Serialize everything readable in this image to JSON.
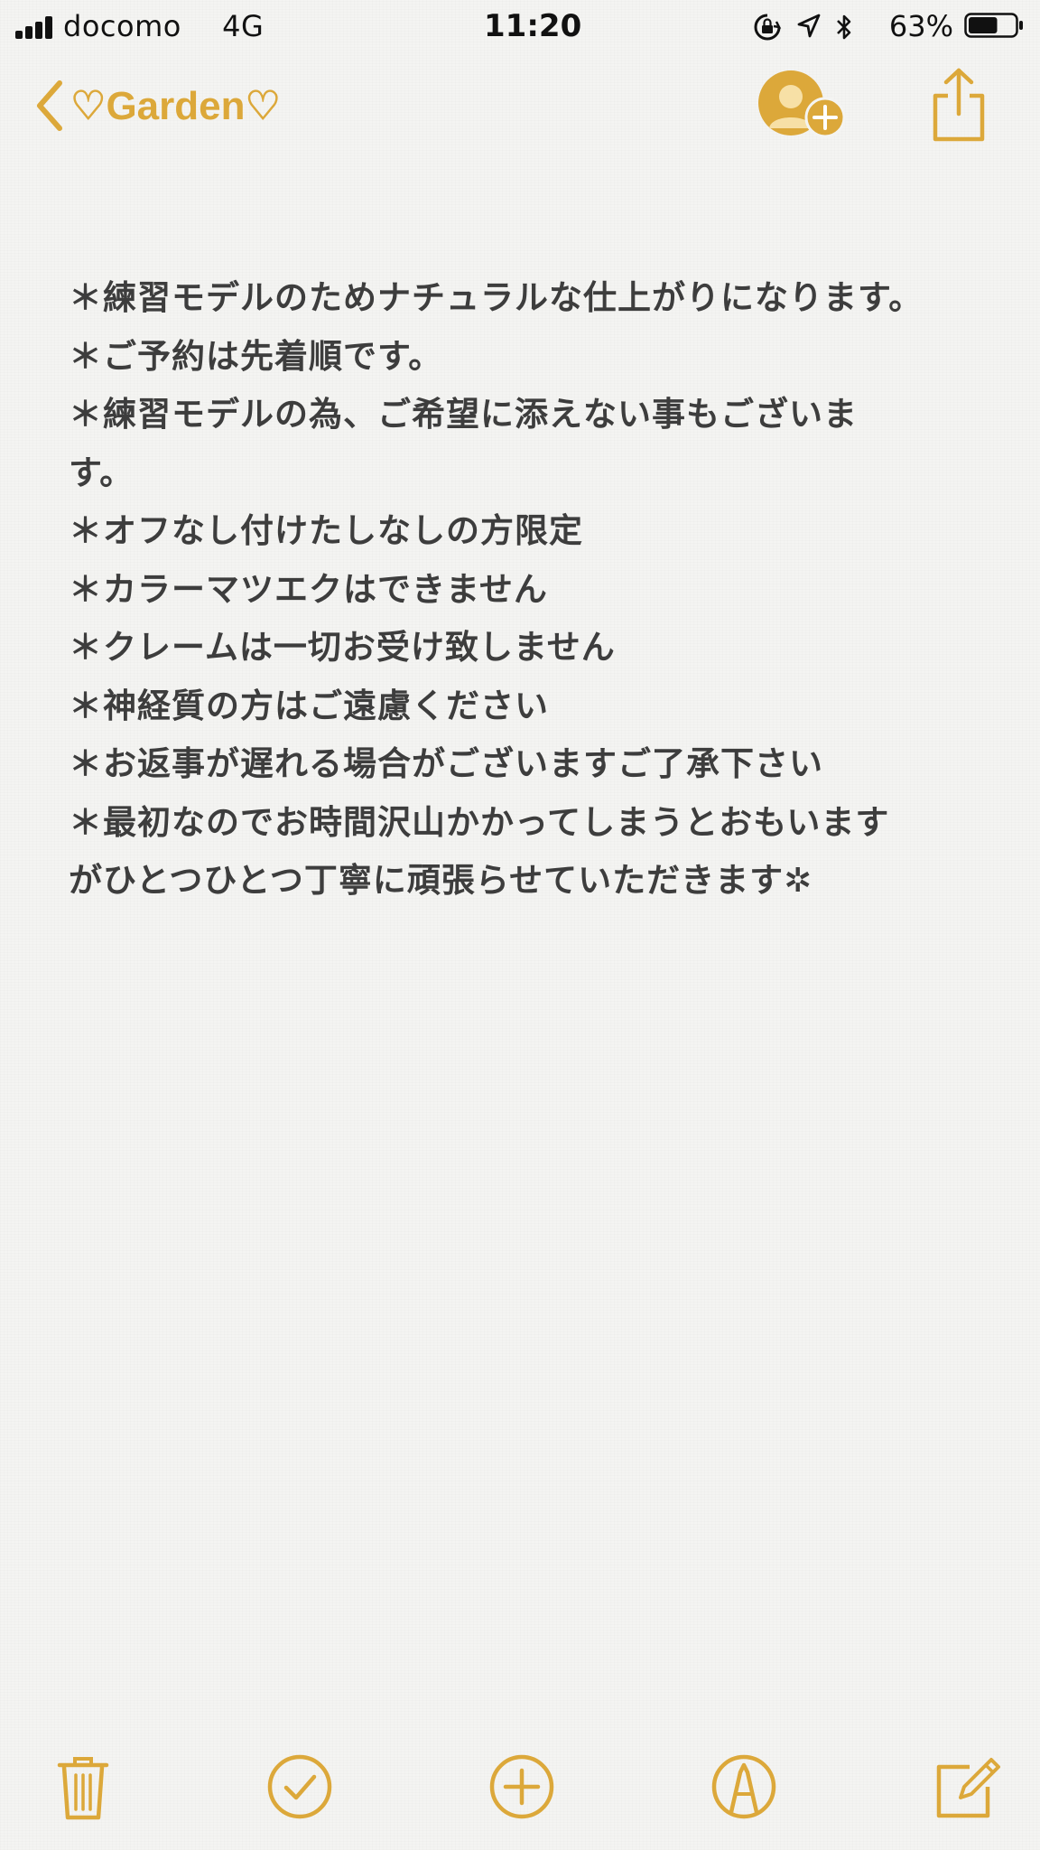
{
  "status_bar": {
    "carrier": "docomo",
    "network": "4G",
    "time": "11:20",
    "battery_percent": "63%",
    "battery_level": 0.63,
    "icons": [
      "signal-icon",
      "rotation-lock-icon",
      "location-icon",
      "bluetooth-icon",
      "battery-icon"
    ]
  },
  "nav": {
    "back_label": "♡Garden♡",
    "icons": [
      "chevron-left-icon",
      "add-person-icon",
      "share-icon"
    ]
  },
  "note": {
    "lines": [
      "＊練習モデルのためナチュラルな仕上がりになります。",
      "＊ご予約は先着順です。",
      "＊練習モデルの為、ご希望に添えない事もございま",
      "す。",
      "＊オフなし付けたしなしの方限定",
      "＊カラーマツエクはできません",
      "＊クレームは一切お受け致しません",
      "＊神経質の方はご遠慮ください",
      "＊お返事が遅れる場合がございますご了承下さい",
      "＊最初なのでお時間沢山かかってしまうとおもいます",
      "がひとつひとつ丁寧に頑張らせていただきます✲"
    ]
  },
  "toolbar": {
    "icons": [
      "trash-icon",
      "checklist-icon",
      "add-icon",
      "markup-icon",
      "compose-icon"
    ]
  },
  "colors": {
    "accent": "#dca83a",
    "text": "#3d3d3d",
    "background": "#f4f4f2"
  }
}
